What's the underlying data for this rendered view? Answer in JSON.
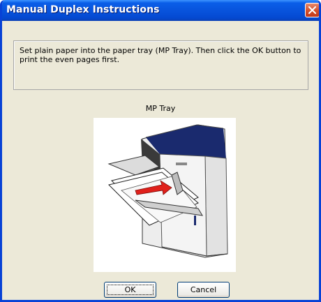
{
  "window": {
    "title": "Manual Duplex Instructions",
    "close_icon": "close-x-icon"
  },
  "message": "Set plain paper into the paper tray (MP Tray). Then click the OK button to print the even pages first.",
  "tray_label": "MP Tray",
  "illustration": {
    "icon": "printer-mp-tray-illustration"
  },
  "buttons": {
    "ok": "OK",
    "cancel": "Cancel"
  },
  "colors": {
    "titlebar": "#0854dd",
    "close": "#d4502a",
    "face": "#ece9d8",
    "arrow": "#e0201b"
  }
}
